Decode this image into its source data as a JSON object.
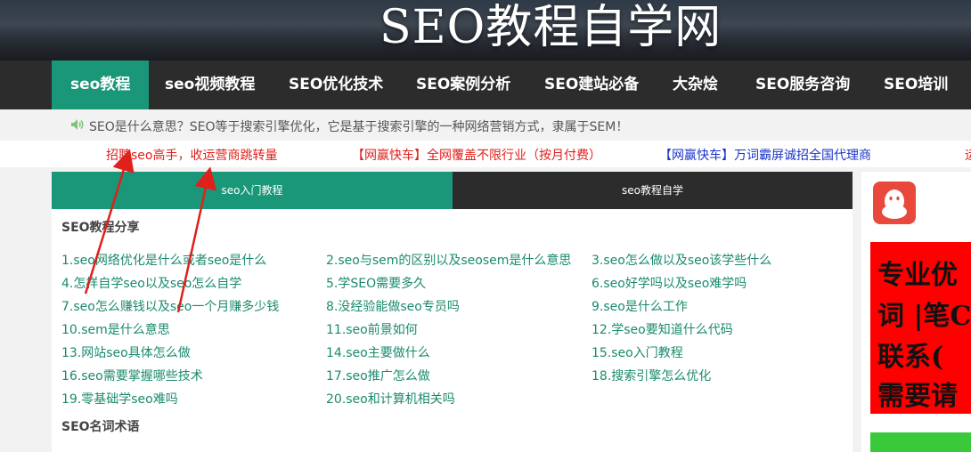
{
  "banner": {
    "title": "SEO教程自学网"
  },
  "nav": {
    "items": [
      {
        "label": "seo教程"
      },
      {
        "label": "seo视频教程"
      },
      {
        "label": "SEO优化技术"
      },
      {
        "label": "SEO案例分析"
      },
      {
        "label": "SEO建站必备"
      },
      {
        "label": "大杂烩"
      },
      {
        "label": "SEO服务咨询"
      },
      {
        "label": "SEO培训"
      }
    ]
  },
  "notice": {
    "text": "SEO是什么意思？SEO等于搜索引擎优化，它是基于搜索引擎的一种网络营销方式，隶属于SEM！"
  },
  "ads": [
    {
      "text": "招聘seo高手，收运营商跳转量",
      "color": "#e0201b"
    },
    {
      "text": "【网赢快车】全网覆盖不限行业（按月付费）",
      "color": "#e0201b"
    },
    {
      "text": "【网赢快车】万词霸屏诚招全国代理商",
      "color": "#1a33c8"
    },
    {
      "text": "运",
      "color": "#e0201b"
    }
  ],
  "tabs": [
    {
      "label": "seo入门教程"
    },
    {
      "label": "seo教程自学"
    }
  ],
  "section1": {
    "heading": "SEO教程分享"
  },
  "section2": {
    "heading": "SEO名词术语"
  },
  "links": [
    "1.seo网络优化是什么或者seo是什么",
    "2.seo与sem的区别以及seosem是什么意思",
    "3.seo怎么做以及seo该学些什么",
    "4.怎样自学seo以及seo怎么自学",
    "5.学SEO需要多久",
    "6.seo好学吗以及seo难学吗",
    "7.seo怎么赚钱以及seo一个月赚多少钱",
    "8.没经验能做seo专员吗",
    "9.seo是什么工作",
    "10.sem是什么意思",
    "11.seo前景如何",
    "12.学seo要知道什么代码",
    "13.网站seo具体怎么做",
    "14.seo主要做什么",
    "15.seo入门教程",
    "16.seo需要掌握哪些技术",
    "17.seo推广怎么做",
    "18.搜索引擎怎么优化",
    "19.零基础学seo难吗",
    "20.seo和计算机相关吗"
  ],
  "side": {
    "qq_icon": "qq-penguin-icon",
    "red_ad_lines": [
      "专业优",
      "词 |笔C词",
      "联系(",
      "需要请"
    ]
  },
  "colors": {
    "accent": "#1a9678",
    "nav_bg": "#2c2c2c",
    "link": "#1a8a6e",
    "arrow": "#e0201b"
  }
}
